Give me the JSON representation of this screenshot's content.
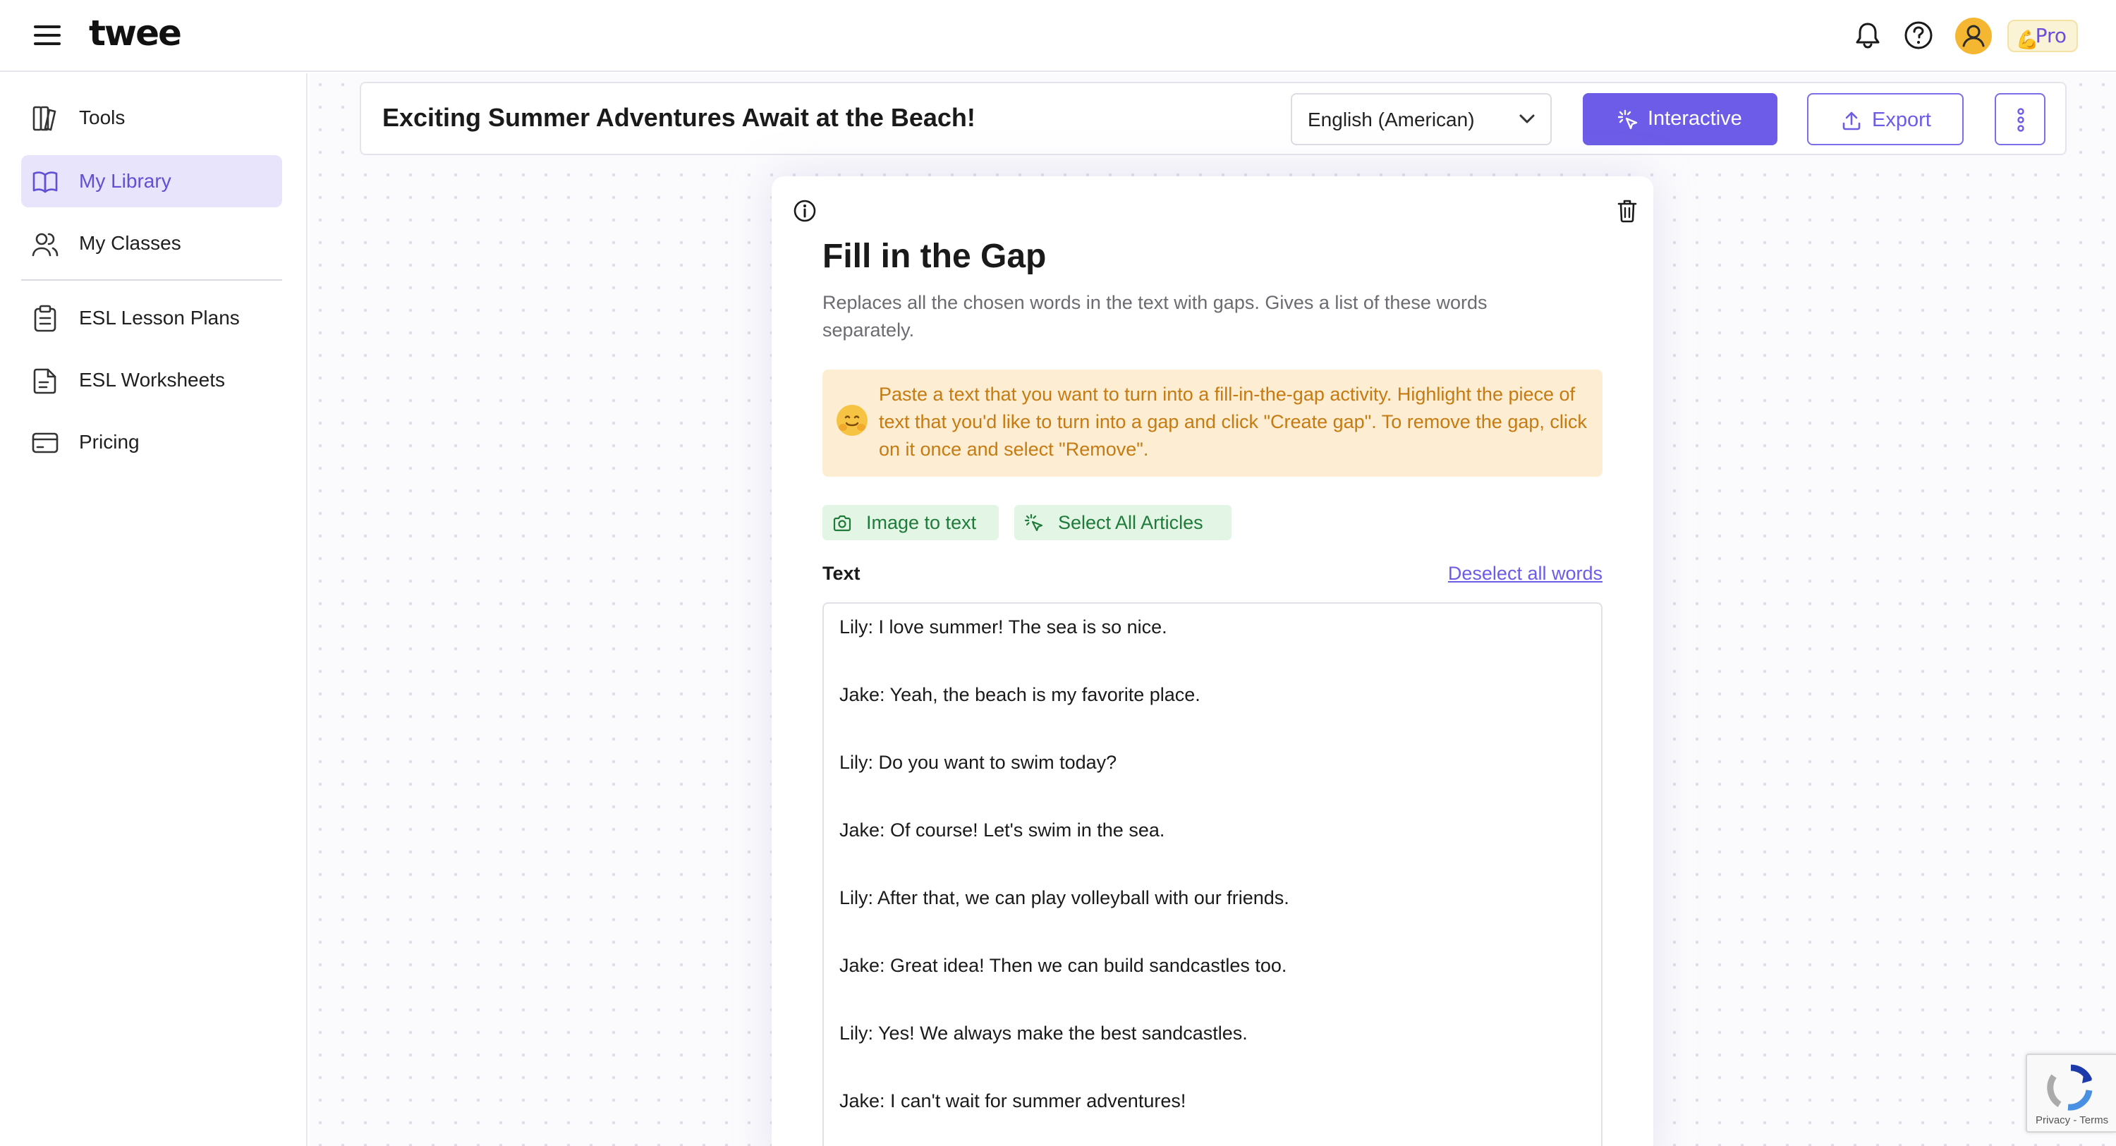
{
  "app": {
    "logo": "twee",
    "pro_label": "Pro"
  },
  "sidebar": {
    "items": [
      {
        "label": "Tools",
        "icon": "book-columns-icon"
      },
      {
        "label": "My Library",
        "icon": "open-book-icon",
        "active": true
      },
      {
        "label": "My Classes",
        "icon": "users-icon"
      },
      {
        "label": "ESL Lesson Plans",
        "icon": "clipboard-icon"
      },
      {
        "label": "ESL Worksheets",
        "icon": "document-icon"
      },
      {
        "label": "Pricing",
        "icon": "credit-card-icon"
      }
    ]
  },
  "header": {
    "title": "Exciting Summer Adventures Await at the Beach!",
    "language": "English (American)",
    "interactive_label": "Interactive",
    "export_label": "Export"
  },
  "tool": {
    "title": "Fill in the Gap",
    "description": "Replaces all the chosen words in the text with gaps. Gives a list of these words separately.",
    "tip": "Paste a text that you want to turn into a fill-in-the-gap activity. Highlight the piece of text that you'd like to turn into a gap and click \"Create gap\". To remove the gap, click on it once and select \"Remove\".",
    "image_to_text_label": "Image to text",
    "select_articles_label": "Select All Articles",
    "text_label": "Text",
    "deselect_label": "Deselect all words",
    "lines": [
      "Lily: I love summer! The sea is so nice.",
      "Jake: Yeah, the beach is my favorite place.",
      "Lily: Do you want to swim today?",
      "Jake: Of course! Let's swim in the sea.",
      "Lily: After that, we can play volleyball with our friends.",
      "Jake: Great idea! Then we can build sandcastles too.",
      "Lily: Yes! We always make the best sandcastles.",
      "Jake: I can't wait for summer adventures!"
    ]
  },
  "recaptcha": {
    "terms": "Privacy - Terms"
  },
  "colors": {
    "accent": "#6c5ce7",
    "active_nav_bg": "#e7e4fb",
    "tip_bg": "#fdedd3",
    "tip_text": "#c57b12",
    "chip_bg": "#e3f5e4",
    "chip_text": "#1e7b3a"
  }
}
